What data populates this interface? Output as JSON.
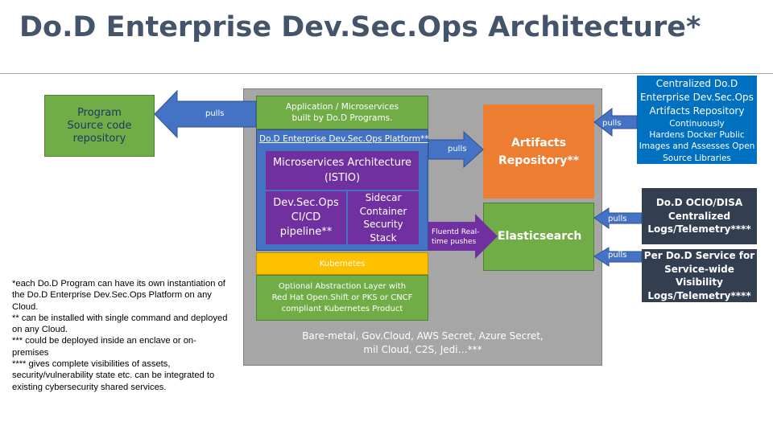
{
  "title": "Do.D Enterprise Dev.Sec.Ops Architecture*",
  "boxes": {
    "program_source": "Program\nSource code\nrepository",
    "app_microservices": "Application / Microservices\nbuilt by Do.D Programs.",
    "platform": "Do.D Enterprise Dev.Sec.Ops Platform**",
    "microservices_arch": "Microservices Architecture\n(ISTIO)",
    "cicd": "Dev.Sec.Ops\nCI/CD\npipeline**",
    "sidecar": "Sidecar\nContainer\nSecurity\nStack",
    "kubernetes": "Kubernetes",
    "abstraction": "Optional Abstraction Layer with\nRed Hat Open.Shift or PKS or CNCF\ncompliant Kubernetes Product",
    "bare_metal": "Bare-metal, Gov.Cloud, AWS Secret, Azure Secret,\nmil Cloud, C2S, Jedi…***",
    "artifacts": "Artifacts\nRepository**",
    "elasticsearch": "Elasticsearch",
    "central_repo_title": "Centralized Do.D\nEnterprise Dev.Sec.Ops\nArtifacts Repository",
    "central_repo_sub": "Continuously\nHardens Docker Public\nImages and Assesses Open\nSource Libraries",
    "ocio": "Do.D OCIO/DISA\nCentralized\nLogs/Telemetry****",
    "per_service": "Per Do.D Service for\nService-wide Visibility\nLogs/Telemetry****"
  },
  "arrows": {
    "pulls_program": "pulls",
    "pulls_artifacts": "pulls",
    "pulls_central": "pulls",
    "fluentd": "Fluentd Real-\ntime pushes",
    "pulls_ocio": "pulls",
    "pulls_service": "pulls"
  },
  "footnotes": "*each Do.D Program can have its own instantiation of the Do.D Enterprise Dev.Sec.Ops Platform on any Cloud.\n** can be installed with single command and deployed on any Cloud.\n*** could be deployed inside an enclave or on-premises\n**** gives complete visibilities of assets, security/vulnerability state etc. can be integrated to existing cybersecurity shared services.",
  "colors": {
    "title": "#44546a",
    "green": "#70ad47",
    "blue": "#4472c4",
    "orange": "#ed7d31",
    "purple": "#7030a0",
    "yellow": "#ffc000",
    "gray": "#a6a6a6",
    "dark": "#333f50",
    "link_blue": "#0070c0"
  }
}
